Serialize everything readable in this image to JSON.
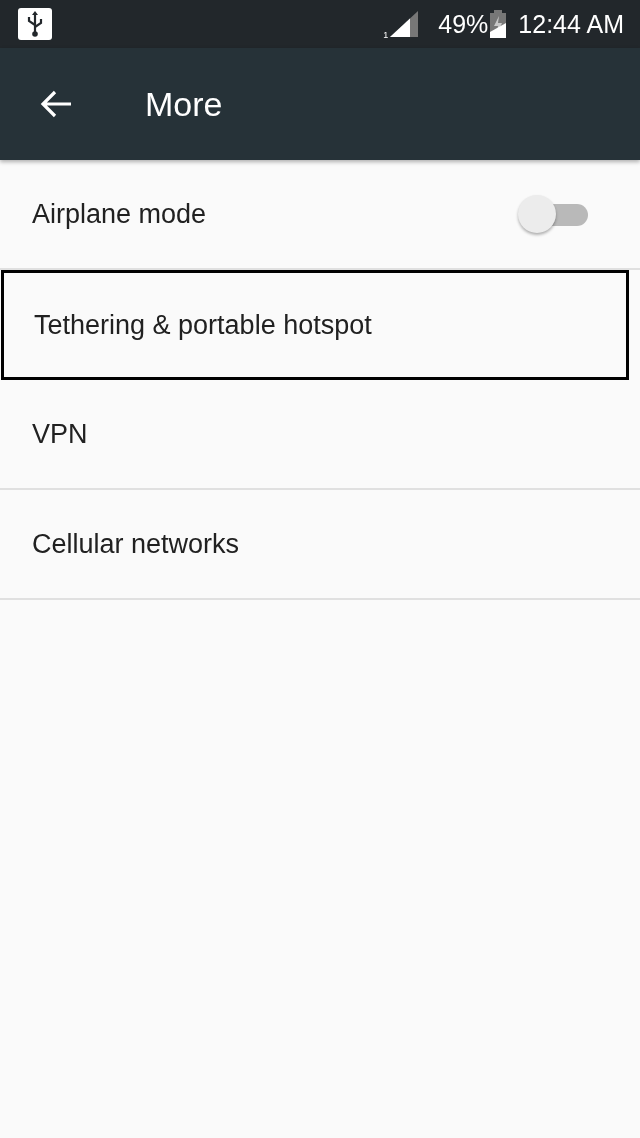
{
  "status_bar": {
    "sim_slot": "1",
    "battery": "49%",
    "time": "12:44 AM"
  },
  "app_bar": {
    "title": "More"
  },
  "items": [
    {
      "kind": "toggle",
      "label": "Airplane mode",
      "on": false,
      "highlighted": false
    },
    {
      "kind": "plain",
      "label": "Tethering & portable hotspot",
      "highlighted": true
    },
    {
      "kind": "plain",
      "label": "VPN",
      "highlighted": false
    },
    {
      "kind": "plain",
      "label": "Cellular networks",
      "highlighted": false
    }
  ]
}
